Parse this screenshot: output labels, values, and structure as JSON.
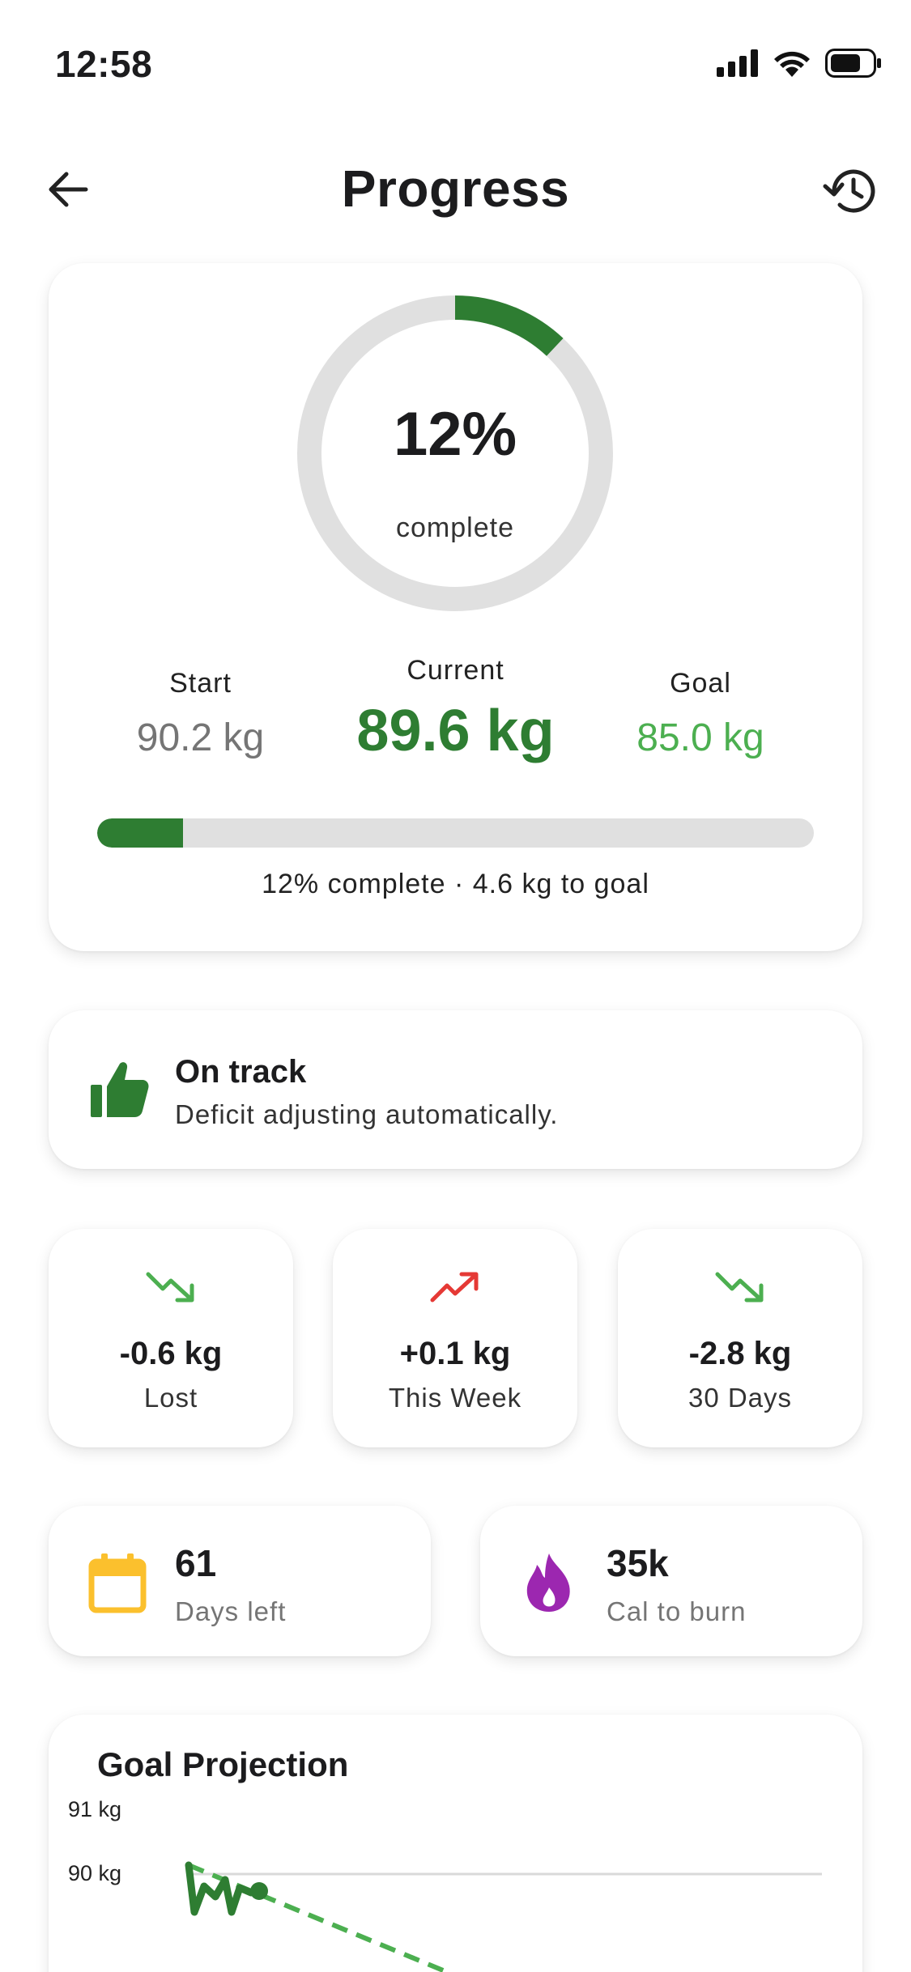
{
  "status": {
    "time": "12:58"
  },
  "nav": {
    "title": "Progress",
    "back_icon": "arrow-left-icon",
    "history_icon": "history-icon"
  },
  "progress": {
    "percent": 12,
    "ring_value": "12%",
    "ring_label": "complete",
    "start_label": "Start",
    "start_value": "90.2 kg",
    "current_label": "Current",
    "current_value": "89.6 kg",
    "goal_label": "Goal",
    "goal_value": "85.0 kg",
    "caption": "12% complete · 4.6 kg to goal"
  },
  "status_card": {
    "icon": "thumbs-up-icon",
    "title": "On track",
    "subtitle": "Deficit adjusting automatically."
  },
  "trends": [
    {
      "icon": "trending-down-icon",
      "color": "#4caf50",
      "value": "-0.6 kg",
      "label": "Lost"
    },
    {
      "icon": "trending-up-icon",
      "color": "#e53935",
      "value": "+0.1 kg",
      "label": "This Week"
    },
    {
      "icon": "trending-down-icon",
      "color": "#4caf50",
      "value": "-2.8 kg",
      "label": "30 Days"
    }
  ],
  "info": [
    {
      "icon": "calendar-icon",
      "color": "#fbc02d",
      "value": "61",
      "label": "Days left"
    },
    {
      "icon": "flame-icon",
      "color": "#9c27b0",
      "value": "35k",
      "label": "Cal to burn"
    }
  ],
  "projection": {
    "title": "Goal Projection",
    "y_labels": [
      "91 kg",
      "90 kg"
    ]
  },
  "colors": {
    "accent": "#2e7d32",
    "accent_light": "#4caf50",
    "track": "#e0e0e0",
    "down": "#4caf50",
    "up": "#e53935",
    "calendar": "#fbc02d",
    "flame": "#9c27b0"
  }
}
